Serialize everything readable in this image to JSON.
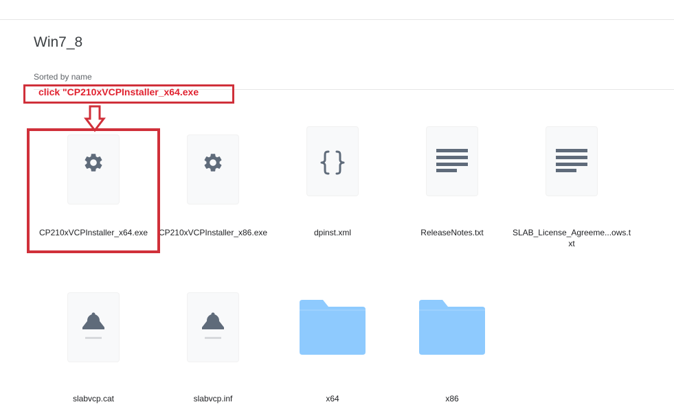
{
  "folder": {
    "title": "Win7_8",
    "sort_label": "Sorted by name"
  },
  "annotation": {
    "text": "click \"CP210xVCPInstaller_x64.exe",
    "color": "#d0303a"
  },
  "files": [
    {
      "name": "CP210xVCPInstaller_x64.exe",
      "icon": "gear-icon"
    },
    {
      "name": "CP210xVCPInstaller_x86.exe",
      "icon": "gear-icon"
    },
    {
      "name": "dpinst.xml",
      "icon": "code-braces-icon"
    },
    {
      "name": "ReleaseNotes.txt",
      "icon": "text-lines-icon"
    },
    {
      "name": "SLAB_License_Agreeme...ows.txt",
      "icon": "text-lines-icon"
    },
    {
      "name": "slabvcp.cat",
      "icon": "certificate-icon"
    },
    {
      "name": "slabvcp.inf",
      "icon": "certificate-icon"
    },
    {
      "name": "x64",
      "icon": "folder-icon"
    },
    {
      "name": "x86",
      "icon": "folder-icon"
    }
  ],
  "colors": {
    "icon_gray": "#5f6b7a",
    "folder_blue": "#8ecafe",
    "thumb_bg": "#f8f9fa"
  }
}
